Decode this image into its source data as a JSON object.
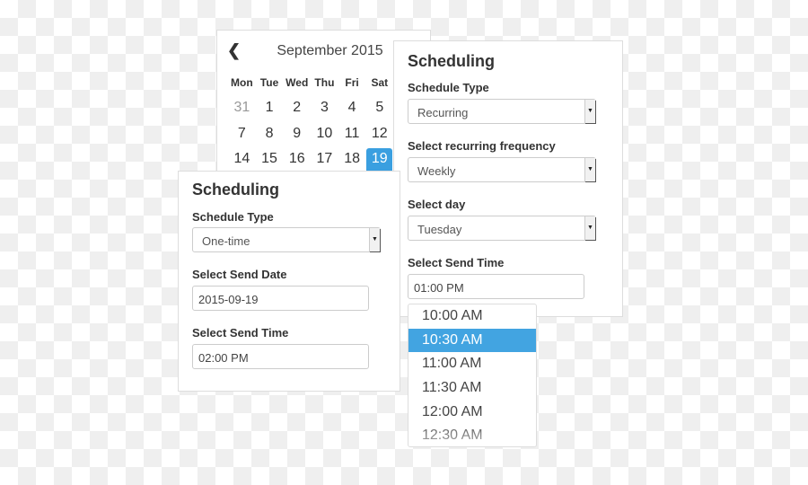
{
  "calendar": {
    "month_label": "September 2015",
    "prev_icon": "chevron-left-icon",
    "weekdays": [
      "Mon",
      "Tue",
      "Wed",
      "Thu",
      "Fri",
      "Sat"
    ],
    "days": [
      [
        "31",
        "1",
        "2",
        "3",
        "4",
        "5"
      ],
      [
        "7",
        "8",
        "9",
        "10",
        "11",
        "12"
      ],
      [
        "14",
        "15",
        "16",
        "17",
        "18",
        "19"
      ]
    ],
    "selected": "19",
    "accent": "#3a9fe0"
  },
  "recurring_panel": {
    "title": "Scheduling",
    "schedule_type_label": "Schedule Type",
    "schedule_type_value": "Recurring",
    "frequency_label": "Select recurring frequency",
    "frequency_value": "Weekly",
    "day_label": "Select day",
    "day_value": "Tuesday",
    "send_time_label": "Select Send Time",
    "send_time_value": "01:00 PM"
  },
  "onetime_panel": {
    "title": "Scheduling",
    "schedule_type_label": "Schedule Type",
    "schedule_type_value": "One-time",
    "send_date_label": "Select Send Date",
    "send_date_value": "2015-09-19",
    "send_time_label": "Select Send Time",
    "send_time_value": "02:00 PM"
  },
  "time_dropdown": {
    "options": [
      "10:00 AM",
      "10:30 AM",
      "11:00 AM",
      "11:30 AM",
      "12:00 AM",
      "12:30 AM"
    ],
    "highlighted": "10:30 AM",
    "highlight_color": "#42a4e1"
  }
}
